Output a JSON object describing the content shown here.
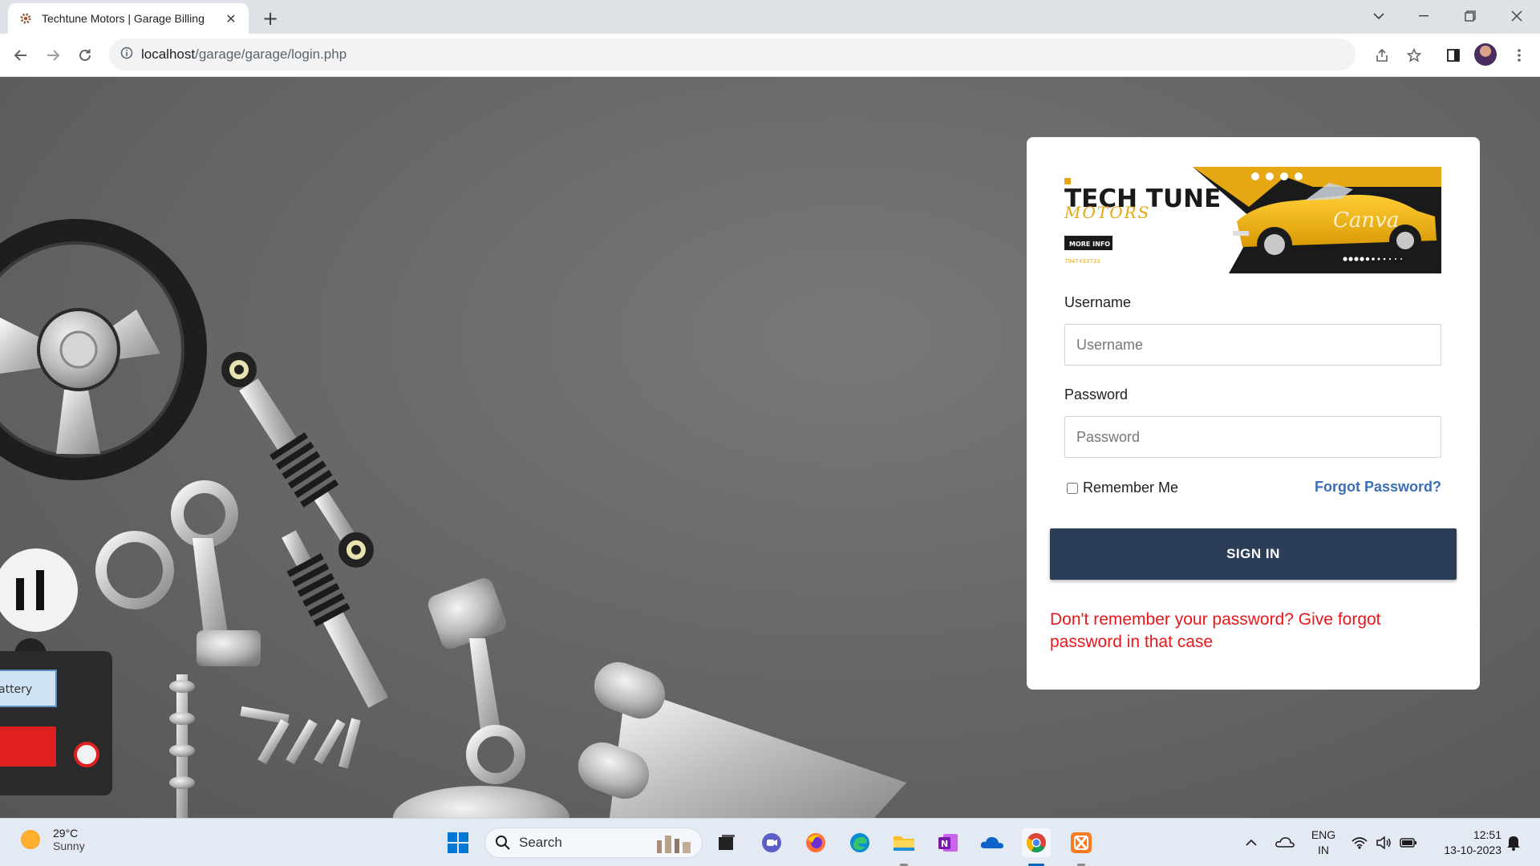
{
  "browser": {
    "tab_title": "Techtune Motors | Garage Billing",
    "url_host": "localhost",
    "url_path": "/garage/garage/login.php"
  },
  "brand": {
    "title": "TECH TUNE",
    "subtitle": "MOTORS",
    "more_info": "MORE INFO",
    "phone": "7947433733",
    "watermark": "Canva"
  },
  "login": {
    "username_label": "Username",
    "username_placeholder": "Username",
    "password_label": "Password",
    "password_placeholder": "Password",
    "remember_label": "Remember Me",
    "forgot_label": "Forgot Password?",
    "signin_label": "SIGN IN",
    "warning_text": "Don't remember your password? Give forgot password in that case"
  },
  "taskbar": {
    "temperature": "29°C",
    "weather": "Sunny",
    "search_label": "Search",
    "language_line1": "ENG",
    "language_line2": "IN",
    "time": "12:51",
    "date": "13-10-2023"
  },
  "colors": {
    "signin_bg": "#2c3e57",
    "warning": "#e8171b",
    "link": "#3b6fb5",
    "banner_yellow": "#e5a712"
  }
}
